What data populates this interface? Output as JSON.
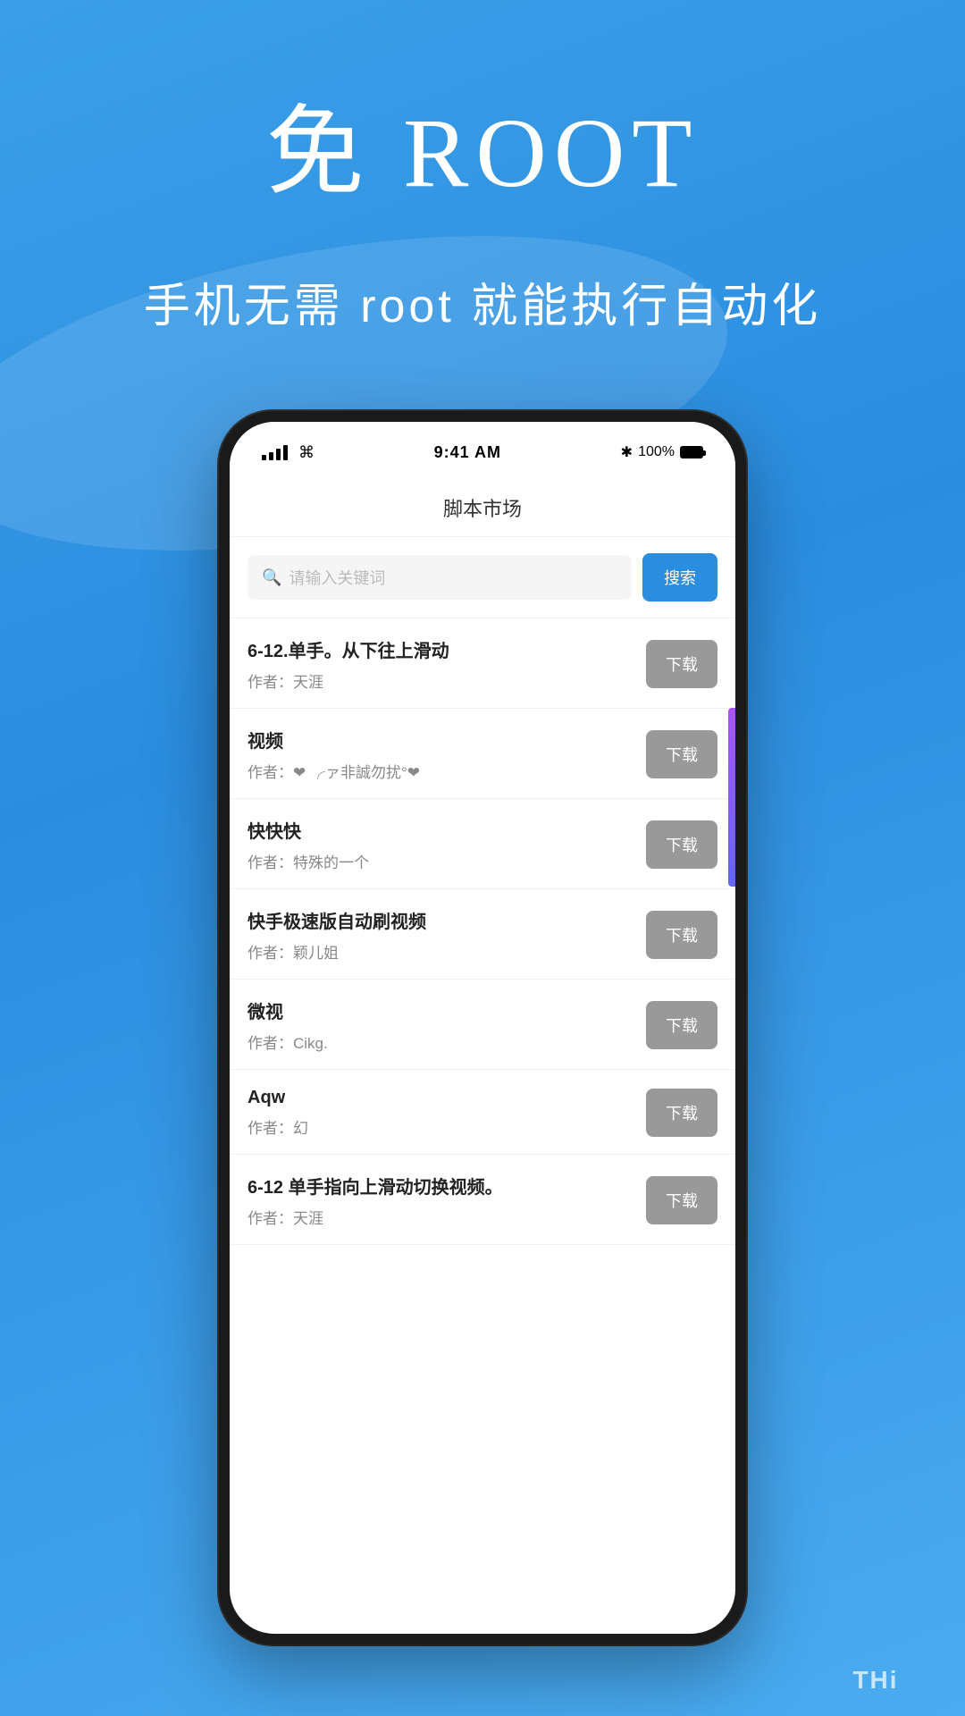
{
  "hero": {
    "title": "免 ROOT",
    "subtitle": "手机无需 root 就能执行自动化"
  },
  "phone": {
    "status_bar": {
      "time": "9:41 AM",
      "battery": "100%",
      "bluetooth": "✱"
    },
    "app_title": "脚本市场",
    "search": {
      "placeholder": "请输入关键词",
      "button_label": "搜索"
    },
    "scripts": [
      {
        "name": "6-12.单手。从下往上滑动",
        "author": "作者：天涯",
        "download_label": "下载"
      },
      {
        "name": "视频",
        "author": "作者：❤ ╭ァ非誠勿扰°❤",
        "download_label": "下载"
      },
      {
        "name": "快快快",
        "author": "作者：特殊的一个",
        "download_label": "下载"
      },
      {
        "name": "快手极速版自动刷视频",
        "author": "作者：颖儿姐",
        "download_label": "下载"
      },
      {
        "name": "微视",
        "author": "作者：Cikg.",
        "download_label": "下载"
      },
      {
        "name": "Aqw",
        "author": "作者：幻",
        "download_label": "下载"
      },
      {
        "name": "6-12 单手指向上滑动切换视频。",
        "author": "作者：天涯",
        "download_label": "下载"
      }
    ]
  },
  "watermark": {
    "text": "THi"
  }
}
